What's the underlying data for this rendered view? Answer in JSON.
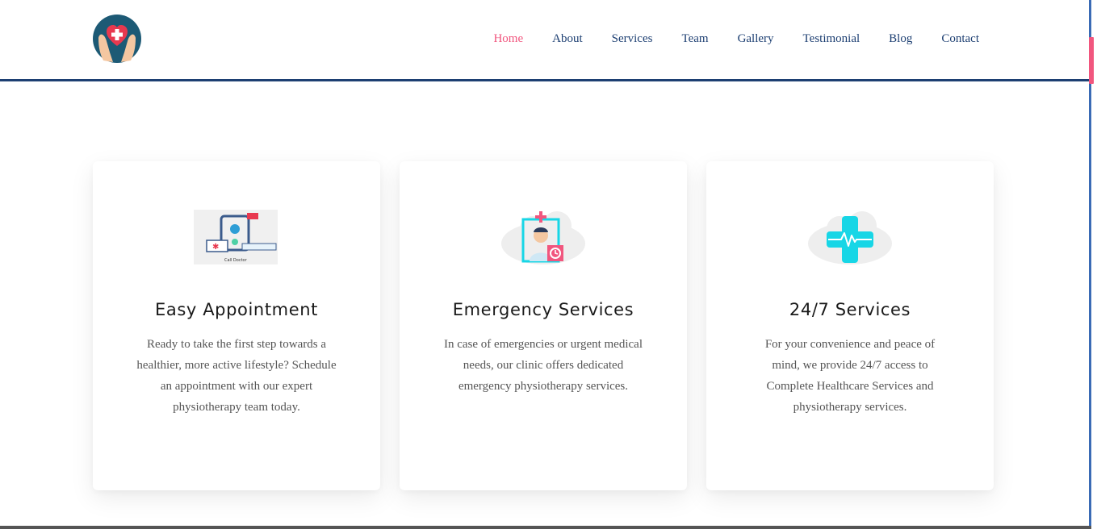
{
  "nav": {
    "items": [
      {
        "label": "Home",
        "active": true
      },
      {
        "label": "About",
        "active": false
      },
      {
        "label": "Services",
        "active": false
      },
      {
        "label": "Team",
        "active": false
      },
      {
        "label": "Gallery",
        "active": false
      },
      {
        "label": "Testimonial",
        "active": false
      },
      {
        "label": "Blog",
        "active": false
      },
      {
        "label": "Contact",
        "active": false
      }
    ]
  },
  "brand": {
    "logo_icon": "heart-hands-icon",
    "accent": "#f1567e",
    "navy": "#1d3f72",
    "cyan": "#17d6e6"
  },
  "cards": [
    {
      "icon": "call-doctor-icon",
      "icon_caption": "Call Doctor",
      "title": "Easy Appointment",
      "text": "Ready to take the first step towards a healthier, more active lifestyle? Schedule an appointment with our expert physiotherapy team today."
    },
    {
      "icon": "doctor-clock-icon",
      "title": "Emergency Services",
      "text": "In case of emergencies or urgent medical needs, our clinic offers dedicated emergency physiotherapy services."
    },
    {
      "icon": "medical-cross-heartbeat-icon",
      "title": "24/7 Services",
      "text": "For your convenience and peace of mind, we provide 24/7 access to Complete Healthcare Services and physiotherapy services."
    }
  ]
}
